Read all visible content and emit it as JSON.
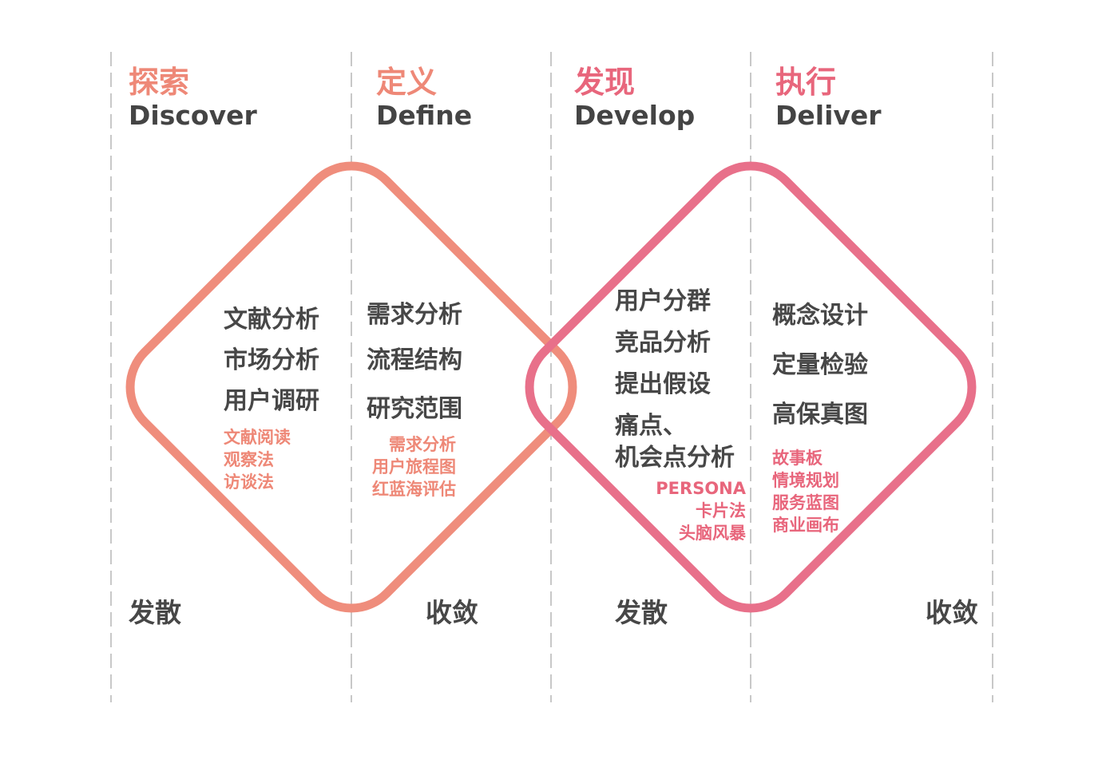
{
  "phases": [
    {
      "cn": "探索",
      "en": "Discover"
    },
    {
      "cn": "定义",
      "en": "Define"
    },
    {
      "cn": "发现",
      "en": "Develop"
    },
    {
      "cn": "执行",
      "en": "Deliver"
    }
  ],
  "discover": {
    "methods": [
      "文献分析",
      "市场分析",
      "用户调研"
    ],
    "tools": [
      "文献阅读",
      "观察法",
      "访谈法"
    ]
  },
  "define": {
    "methods": [
      "需求分析",
      "流程结构",
      "研究范围"
    ],
    "tools": [
      "需求分析",
      "用户旅程图",
      "红蓝海评估"
    ]
  },
  "develop": {
    "methods": [
      "用户分群",
      "竞品分析",
      "提出假设",
      "痛点、",
      "机会点分析"
    ],
    "tools": [
      "PERSONA",
      "卡片法",
      "头脑风暴"
    ]
  },
  "deliver": {
    "methods": [
      "概念设计",
      "定量检验",
      "高保真图"
    ],
    "tools": [
      "故事板",
      "情境规划",
      "服务蓝图",
      "商业画布"
    ]
  },
  "bottom": {
    "diverge_1": "发散",
    "converge_1": "收敛",
    "diverge_2": "发散",
    "converge_2": "收敛"
  },
  "colors": {
    "diamond_1": "#ef8d7c",
    "diamond_2": "#e8708a",
    "phase_1": "#ee8877",
    "phase_2": "#e8667c",
    "text": "#474747",
    "guide": "#b5b5b5"
  }
}
